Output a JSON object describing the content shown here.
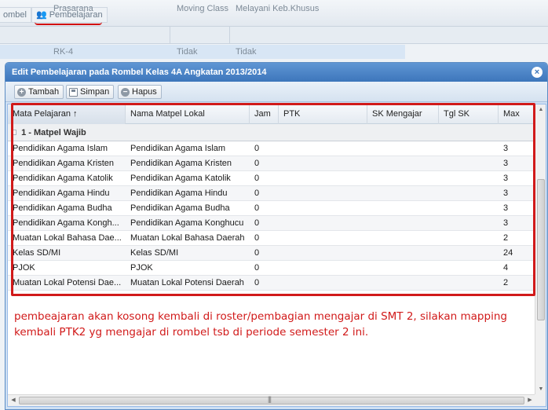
{
  "background": {
    "tabs": [
      {
        "label": "ombel"
      },
      {
        "label": "Pembelajaran"
      }
    ],
    "grid_columns": [
      "Prasarana",
      "Moving Class",
      "Melayani Keb.Khusus"
    ],
    "row": [
      "RK-4",
      "Tidak",
      "Tidak"
    ]
  },
  "window": {
    "title": "Edit Pembelajaran pada Rombel Kelas 4A Angkatan 2013/2014",
    "close_icon": "×",
    "toolbar": {
      "add_label": "Tambah",
      "save_label": "Simpan",
      "delete_label": "Hapus"
    },
    "columns": [
      "Mata Pelajaran ↑",
      "Nama Matpel Lokal",
      "Jam",
      "PTK",
      "SK Mengajar",
      "Tgl SK",
      "Max"
    ],
    "group_label": "1 - Matpel Wajib",
    "rows": [
      {
        "mapel": "Pendidikan Agama Islam",
        "lokal": "Pendidikan Agama Islam",
        "jam": "0",
        "max": "3"
      },
      {
        "mapel": "Pendidikan Agama Kristen",
        "lokal": "Pendidikan Agama Kristen",
        "jam": "0",
        "max": "3"
      },
      {
        "mapel": "Pendidikan Agama Katolik",
        "lokal": "Pendidikan Agama Katolik",
        "jam": "0",
        "max": "3"
      },
      {
        "mapel": "Pendidikan Agama Hindu",
        "lokal": "Pendidikan Agama Hindu",
        "jam": "0",
        "max": "3"
      },
      {
        "mapel": "Pendidikan Agama Budha",
        "lokal": "Pendidikan Agama Budha",
        "jam": "0",
        "max": "3"
      },
      {
        "mapel": "Pendidikan Agama Kongh...",
        "lokal": "Pendidikan Agama Konghucu",
        "jam": "0",
        "max": "3"
      },
      {
        "mapel": "Muatan Lokal Bahasa Dae...",
        "lokal": "Muatan Lokal Bahasa Daerah",
        "jam": "0",
        "max": "2"
      },
      {
        "mapel": "Kelas SD/MI",
        "lokal": "Kelas SD/MI",
        "jam": "0",
        "max": "24"
      },
      {
        "mapel": "PJOK",
        "lokal": "PJOK",
        "jam": "0",
        "max": "4"
      },
      {
        "mapel": "Muatan Lokal Potensi Dae...",
        "lokal": "Muatan Lokal Potensi Daerah",
        "jam": "0",
        "max": "2"
      }
    ]
  },
  "annotation": {
    "text": "pembeajaran akan kosong kembali di roster/pembagian mengajar di SMT 2, silakan mapping kembali PTK2 yg mengajar di rombel tsb  di periode semester 2 ini.",
    "color": "#d11a1a"
  }
}
